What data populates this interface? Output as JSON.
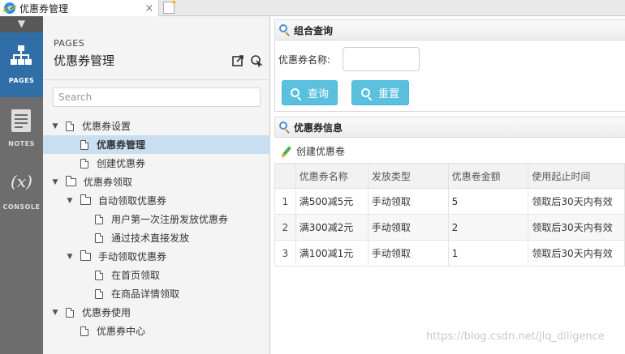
{
  "tab": {
    "title": "优惠券管理",
    "close": "×"
  },
  "rail": {
    "items": [
      {
        "label": "PAGES",
        "icon": "sitemap-icon"
      },
      {
        "label": "NOTES",
        "icon": "notes-icon"
      },
      {
        "label": "CONSOLE",
        "icon": "console-icon",
        "glyph": "(x)"
      }
    ]
  },
  "pages_panel": {
    "header": "PAGES",
    "title": "优惠券管理",
    "search_placeholder": "Search",
    "tree": [
      {
        "label": "优惠券设置",
        "type": "doc",
        "level": 0,
        "caret": "▼"
      },
      {
        "label": "优惠券管理",
        "type": "doc",
        "level": 1,
        "caret": "",
        "selected": true
      },
      {
        "label": "创建优惠券",
        "type": "doc",
        "level": 1,
        "caret": ""
      },
      {
        "label": "优惠券领取",
        "type": "folder",
        "level": 0,
        "caret": "▼"
      },
      {
        "label": "自动领取优惠券",
        "type": "folder",
        "level": 1,
        "caret": "▼"
      },
      {
        "label": "用户第一次注册发放优惠券",
        "type": "doc",
        "level": 2,
        "caret": ""
      },
      {
        "label": "通过技术直接发放",
        "type": "doc",
        "level": 2,
        "caret": ""
      },
      {
        "label": "手动领取优惠券",
        "type": "folder",
        "level": 1,
        "caret": "▼"
      },
      {
        "label": "在首页领取",
        "type": "doc",
        "level": 2,
        "caret": ""
      },
      {
        "label": "在商品详情领取",
        "type": "doc",
        "level": 2,
        "caret": ""
      },
      {
        "label": "优惠券使用",
        "type": "doc",
        "level": 0,
        "caret": "▼"
      },
      {
        "label": "优惠券中心",
        "type": "doc",
        "level": 1,
        "caret": ""
      }
    ]
  },
  "query": {
    "title": "组合查询",
    "name_label": "优惠券名称:",
    "name_value": "",
    "search_button": "查询",
    "reset_button": "重置"
  },
  "info": {
    "title": "优惠券信息",
    "create_label": "创建优惠卷",
    "columns": [
      "",
      "优惠券名称",
      "发放类型",
      "优惠卷金额",
      "使用起止时间"
    ],
    "rows": [
      [
        "1",
        "满500减5元",
        "手动领取",
        "5",
        "领取后30天内有效"
      ],
      [
        "2",
        "满300减2元",
        "手动领取",
        "2",
        "领取后30天内有效"
      ],
      [
        "3",
        "满100减1元",
        "手动领取",
        "1",
        "领取后30天内有效"
      ]
    ]
  },
  "watermark": "https://blog.csdn.net/jlq_diligence",
  "colors": {
    "accent": "#2f6ea6",
    "button": "#5bc0de",
    "selected_row": "#c9dff1"
  }
}
